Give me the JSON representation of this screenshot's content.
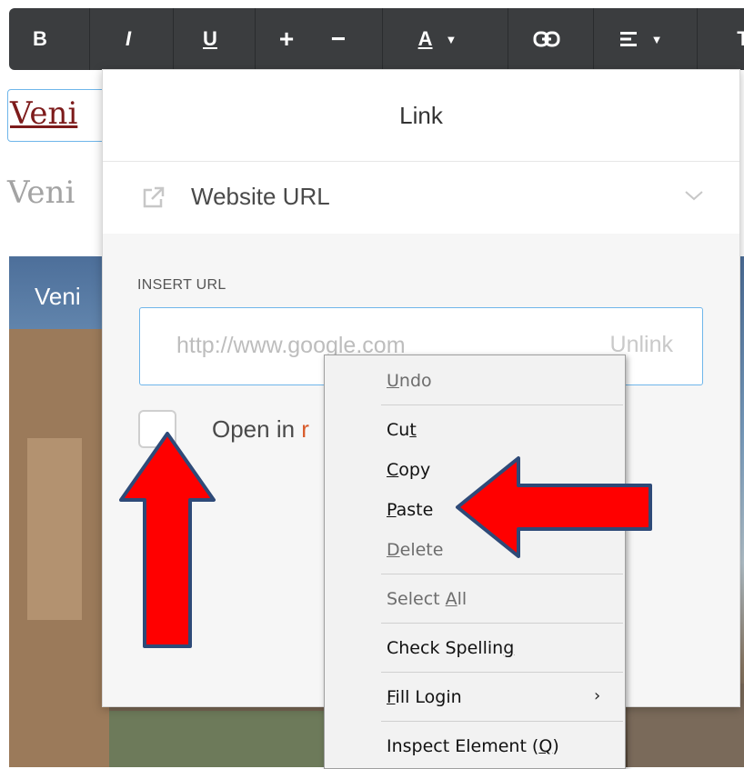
{
  "toolbar": {
    "buttons": [
      {
        "label": "B",
        "name": "bold"
      },
      {
        "label": "I",
        "name": "italic"
      },
      {
        "label": "U",
        "name": "underline"
      },
      {
        "label": "+",
        "name": "increase-size"
      },
      {
        "label": "−",
        "name": "decrease-size"
      },
      {
        "label": "A",
        "name": "text-color"
      },
      {
        "label": "",
        "name": "link-icon"
      },
      {
        "label": "",
        "name": "align-icon"
      },
      {
        "label": "T",
        "name": "text-style"
      }
    ]
  },
  "background": {
    "heading1": "Veni",
    "heading2": "Veni",
    "photo_label": "Veni"
  },
  "link_panel": {
    "title": "Link",
    "type_select": {
      "selected": "Website URL",
      "icon": "external-link-icon"
    },
    "insert_url_label": "INSERT URL",
    "url_placeholder": "http://www.google.com",
    "unlink_label": "Unlink",
    "open_new_label_prefix": "Open in ",
    "open_new_label_suffix": "r"
  },
  "context_menu": {
    "undo": {
      "pre": "",
      "u": "U",
      "post": "ndo"
    },
    "cut": {
      "pre": "Cu",
      "u": "t",
      "post": ""
    },
    "copy": {
      "pre": "",
      "u": "C",
      "post": "opy"
    },
    "paste": {
      "pre": "",
      "u": "P",
      "post": "aste"
    },
    "delete": {
      "pre": "",
      "u": "D",
      "post": "elete"
    },
    "select_all": {
      "pre": "Select ",
      "u": "A",
      "post": "ll"
    },
    "check_spelling": {
      "pre": "Check Spellin",
      "u": "g",
      "post": ""
    },
    "fill_login": {
      "pre": "",
      "u": "F",
      "post": "ill Login"
    },
    "inspect": {
      "pre": "Inspect Element (",
      "u": "Q",
      "post": ")"
    },
    "submenu_arrow": "›"
  },
  "colors": {
    "toolbar_bg": "#3b3d3f",
    "focus_border": "#6fb6ea",
    "arrow_fill": "#ff0000",
    "arrow_border": "#2e4a78"
  }
}
